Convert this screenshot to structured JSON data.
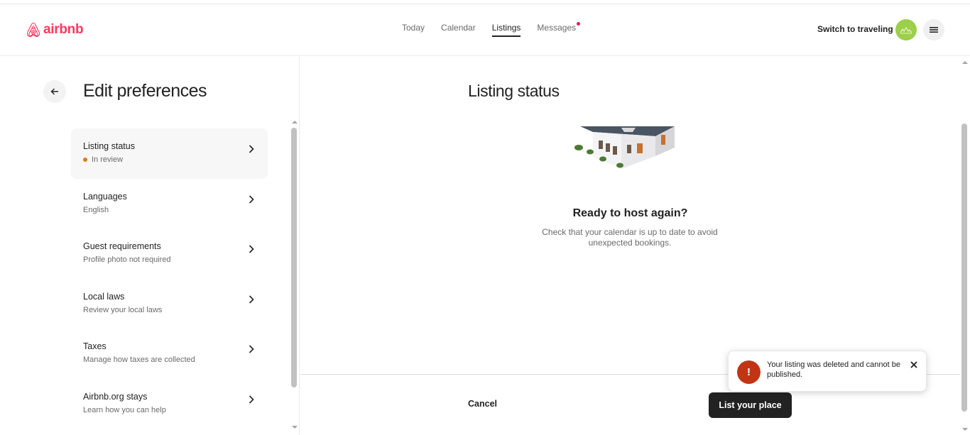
{
  "brand": {
    "name": "airbnb",
    "color": "#ff385c"
  },
  "nav": {
    "items": [
      {
        "label": "Today"
      },
      {
        "label": "Calendar"
      },
      {
        "label": "Listings",
        "active": true
      },
      {
        "label": "Messages",
        "has_notification": true
      }
    ]
  },
  "header": {
    "switch_label": "Switch to traveling"
  },
  "sidebar": {
    "title": "Edit preferences",
    "items": [
      {
        "title": "Listing status",
        "subtitle": "In review",
        "status_color": "#e07912"
      },
      {
        "title": "Languages",
        "subtitle": "English"
      },
      {
        "title": "Guest requirements",
        "subtitle": "Profile photo not required"
      },
      {
        "title": "Local laws",
        "subtitle": "Review your local laws"
      },
      {
        "title": "Taxes",
        "subtitle": "Manage how taxes are collected"
      },
      {
        "title": "Airbnb.org stays",
        "subtitle": "Learn how you can help"
      }
    ]
  },
  "main": {
    "title": "Listing status",
    "ready_title": "Ready to host again?",
    "ready_text": "Check that your calendar is up to date to avoid unexpected bookings.",
    "cancel_label": "Cancel",
    "list_label": "List your place"
  },
  "toast": {
    "icon_glyph": "!",
    "message": "Your listing was deleted and cannot be published.",
    "color": "#c13515"
  }
}
